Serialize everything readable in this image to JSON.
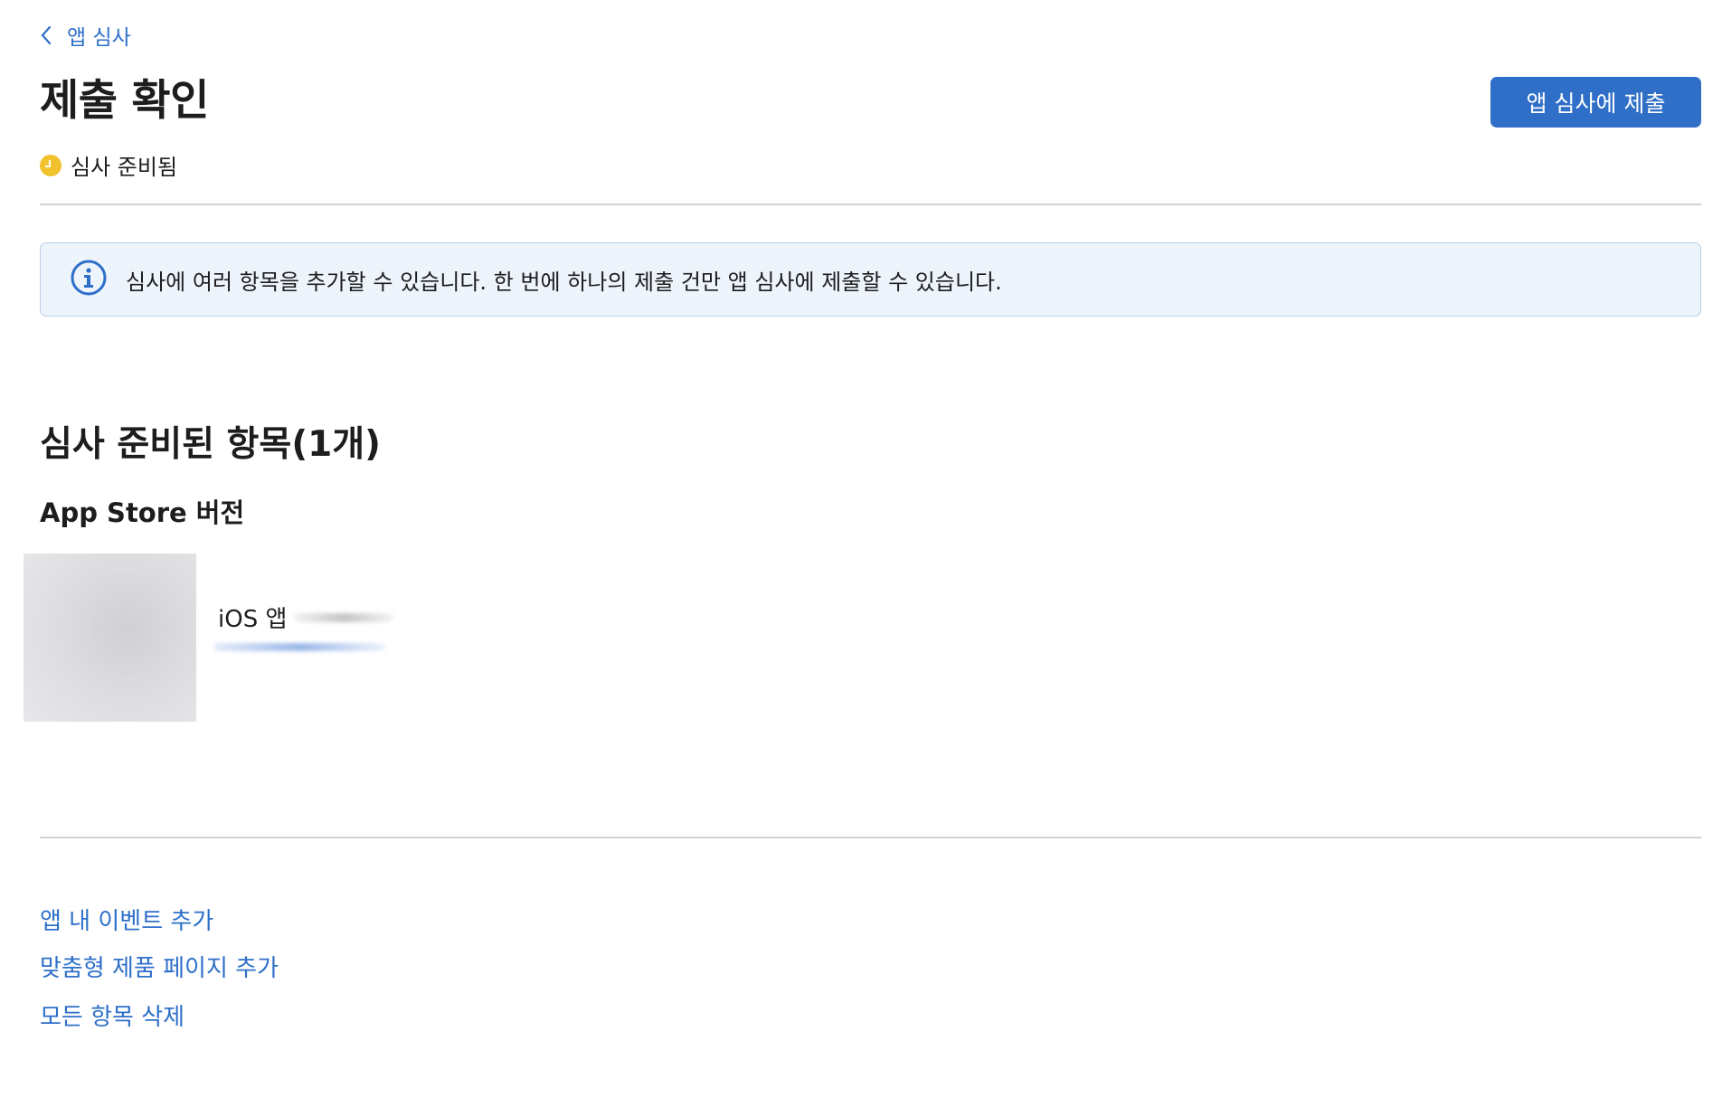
{
  "breadcrumb": {
    "label": "앱 심사",
    "icon": "chevron-left-icon"
  },
  "page": {
    "title": "제출 확인"
  },
  "actions": {
    "submit_label": "앱 심사에 제출"
  },
  "status": {
    "label": "심사 준비됨",
    "color": "#f2c12e",
    "icon": "clock-icon"
  },
  "info_banner": {
    "icon": "info-icon",
    "text": "심사에 여러 항목을 추가할 수 있습니다. 한 번에 하나의 제출 건만 앱 심사에 제출할 수 있습니다."
  },
  "section": {
    "heading": "심사 준비된 항목(1개)",
    "subheading": "App Store 버전",
    "items": [
      {
        "title_prefix": "iOS 앱"
      }
    ]
  },
  "links": [
    {
      "label": "앱 내 이벤트 추가"
    },
    {
      "label": "맞춤형 제품 페이지 추가"
    },
    {
      "label": "모든 항목 삭제"
    }
  ],
  "colors": {
    "accent": "#2e6fc9",
    "button": "#2f6fc7",
    "banner_bg": "#eef4fb"
  }
}
